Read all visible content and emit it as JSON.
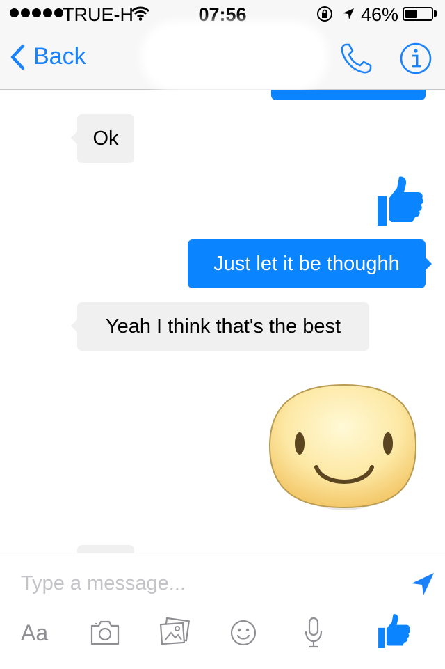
{
  "status_bar": {
    "carrier": "TRUE-H",
    "time": "07:56",
    "battery_percent": "46%",
    "battery_level": 0.46,
    "signal_bars": 5
  },
  "nav": {
    "back_label": "Back",
    "icons": [
      "chevron-left-icon",
      "phone-icon",
      "info-icon"
    ]
  },
  "messages": [
    {
      "direction": "outgoing",
      "type": "text",
      "text": "",
      "partially_visible": true
    },
    {
      "direction": "incoming",
      "type": "text",
      "text": "Ok"
    },
    {
      "direction": "outgoing",
      "type": "sticker",
      "sticker": "thumbs-up-icon"
    },
    {
      "direction": "outgoing",
      "type": "text",
      "text": "Just let it be thoughh"
    },
    {
      "direction": "incoming",
      "type": "text",
      "text": "Yeah I think that's the best"
    },
    {
      "direction": "outgoing",
      "type": "sticker",
      "sticker": "smiley-sticker"
    },
    {
      "direction": "incoming",
      "type": "text",
      "text": "",
      "partially_visible": true
    }
  ],
  "composer": {
    "placeholder": "Type a message...",
    "value": "",
    "format_label": "Aa",
    "toolbar_icons": [
      "camera-icon",
      "gallery-icon",
      "emoji-icon",
      "microphone-icon",
      "like-icon"
    ]
  },
  "colors": {
    "accent": "#1a82fb",
    "outgoing_bubble": "#0a84ff",
    "incoming_bubble": "#f1f0f0",
    "bar_background": "#f7f7f8"
  }
}
